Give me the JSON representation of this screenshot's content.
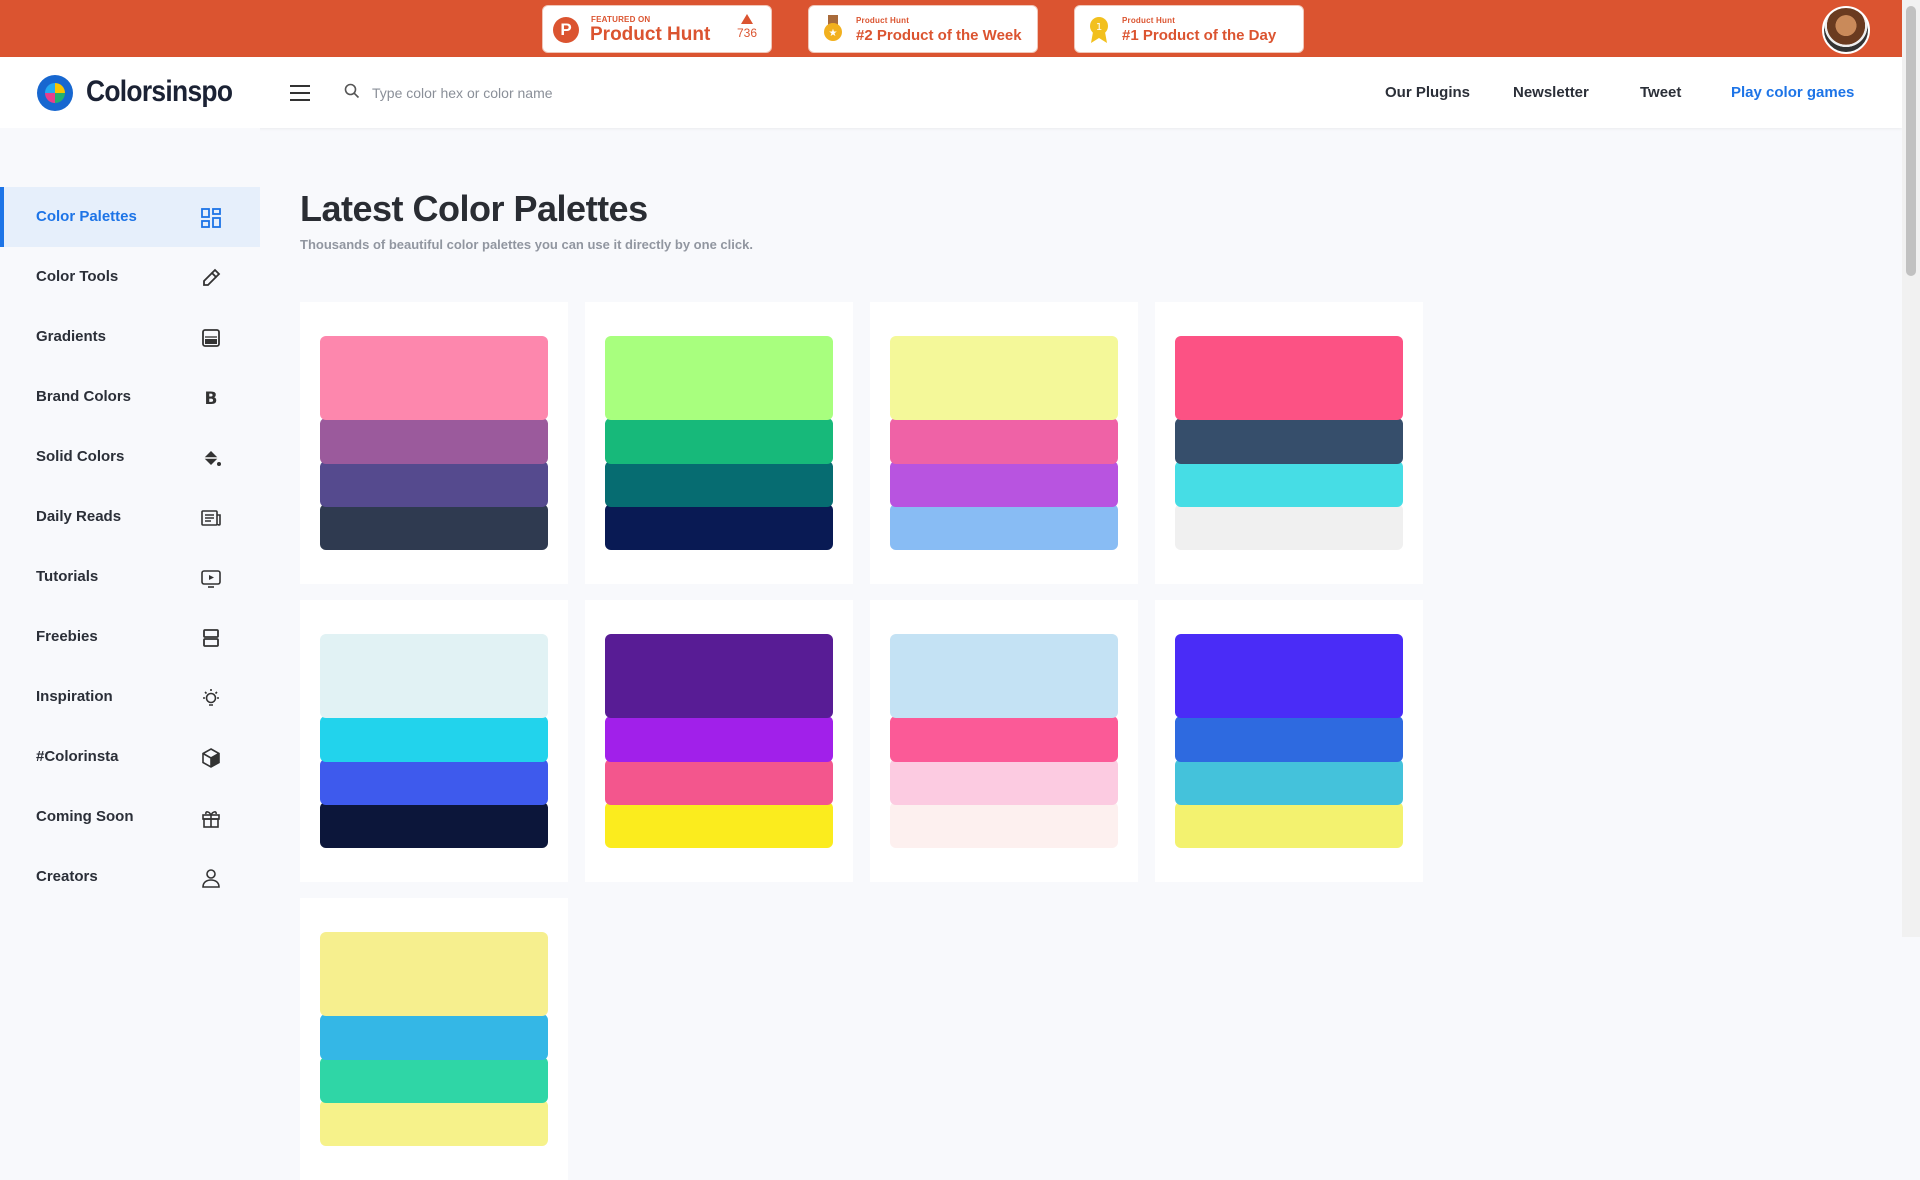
{
  "banner": {
    "badge1": {
      "small": "FEATURED ON",
      "big": "Product Hunt",
      "votes": "736"
    },
    "badge2": {
      "small": "Product Hunt",
      "big": "#2 Product of the Week"
    },
    "badge3": {
      "small": "Product Hunt",
      "big": "#1 Product of the Day"
    }
  },
  "header": {
    "brand": "Colorsinspo",
    "search_placeholder": "Type color hex or color name",
    "nav": [
      "Our Plugins",
      "Newsletter",
      "Tweet",
      "Play color games"
    ]
  },
  "sidebar": {
    "items": [
      {
        "label": "Color Palettes",
        "icon": "grid-icon"
      },
      {
        "label": "Color Tools",
        "icon": "eyedropper-icon"
      },
      {
        "label": "Gradients",
        "icon": "gradient-icon"
      },
      {
        "label": "Brand Colors",
        "icon": "brand-b-icon"
      },
      {
        "label": "Solid Colors",
        "icon": "paint-bucket-icon"
      },
      {
        "label": "Daily Reads",
        "icon": "newspaper-icon"
      },
      {
        "label": "Tutorials",
        "icon": "video-icon"
      },
      {
        "label": "Freebies",
        "icon": "layers-icon"
      },
      {
        "label": "Inspiration",
        "icon": "lightbulb-icon"
      },
      {
        "label": "#Colorinsta",
        "icon": "cube-icon"
      },
      {
        "label": "Coming Soon",
        "icon": "gift-icon"
      },
      {
        "label": "Creators",
        "icon": "user-icon"
      }
    ]
  },
  "main": {
    "title": "Latest Color Palettes",
    "subtitle": "Thousands of beautiful color palettes you can use it directly by one click.",
    "palettes": [
      [
        "#fd87ad",
        "#9b5a9c",
        "#554a8e",
        "#2f3a50"
      ],
      [
        "#a8ff7e",
        "#17b97a",
        "#066c71",
        "#091a54"
      ],
      [
        "#f4f899",
        "#ef62a6",
        "#b854e0",
        "#88bcf4"
      ],
      [
        "#fc5284",
        "#364e6b",
        "#46dde5",
        "#f0f0f0"
      ],
      [
        "#e1f2f4",
        "#22d3ec",
        "#3e5aed",
        "#0c163a"
      ],
      [
        "#581c95",
        "#a120ea",
        "#f3568d",
        "#fbec1e"
      ],
      [
        "#c4e2f4",
        "#fb5a97",
        "#fccbe1",
        "#fdf0ef"
      ],
      [
        "#4a2cf7",
        "#2e6ae0",
        "#44c2db",
        "#f3f26f"
      ],
      [
        "#f6ef8e",
        "#34b7e6",
        "#2fd6a6",
        "#f6f28a"
      ]
    ]
  }
}
